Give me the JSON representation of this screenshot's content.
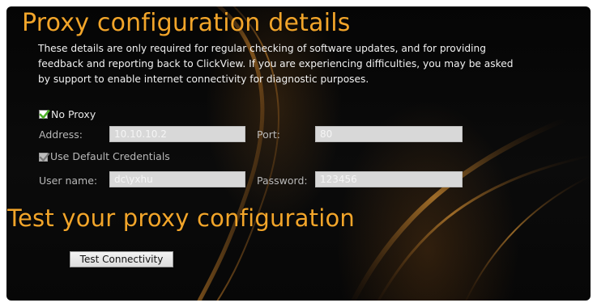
{
  "colors": {
    "accent": "#f2a52a",
    "text": "#f1f1f1",
    "field_bg": "#d8d8d8",
    "background": "#070707"
  },
  "section1": {
    "title": "Proxy configuration details",
    "description_lines": [
      "These details are only required for regular checking of software updates, and for providing",
      "feedback and reporting back to ClickView. If you are experiencing difficulties, you may be asked",
      "by support to enable internet connectivity for diagnostic purposes."
    ]
  },
  "proxy": {
    "no_proxy_label": "No Proxy",
    "no_proxy_checked": true,
    "address_label": "Address:",
    "address_value": "10.10.10.2",
    "port_label": "Port:",
    "port_value": "80",
    "use_default_credentials_label": "Use Default Credentials",
    "use_default_credentials_checked": true,
    "username_label": "User name:",
    "username_value": "dc\\yxhu",
    "password_label": "Password:",
    "password_value": "123456"
  },
  "section2": {
    "title": "Test your proxy configuration",
    "test_button_label": "Test Connectivity"
  }
}
